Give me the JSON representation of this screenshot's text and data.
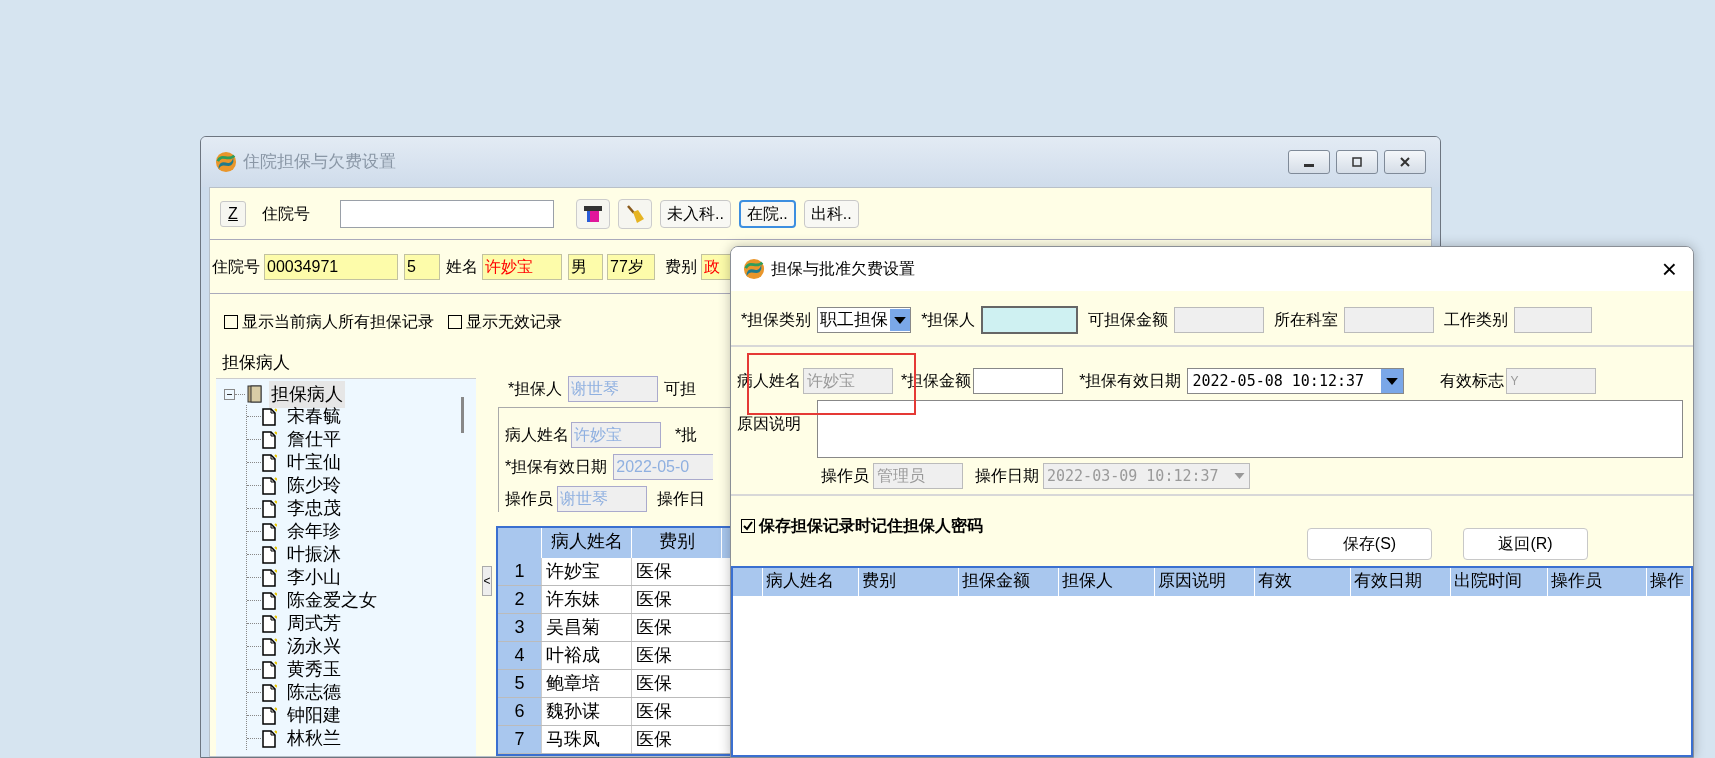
{
  "main_window": {
    "title": "住院担保与欠费设置",
    "toolbar": {
      "z_button": "Z",
      "inpatient_label": "住院号",
      "buttons": [
        {
          "label": "未入科..",
          "selected": false
        },
        {
          "label": "在院..",
          "selected": true
        },
        {
          "label": "出科..",
          "selected": false
        }
      ]
    },
    "patient_info": {
      "id_label": "住院号",
      "id": "00034971",
      "bed": "5",
      "name_label": "姓名",
      "name": "许妙宝",
      "sex": "男",
      "age": "77岁",
      "fee_label": "费别",
      "fee": "政"
    },
    "filters": [
      {
        "label": "显示当前病人所有担保记录",
        "checked": false
      },
      {
        "label": "显示无效记录",
        "checked": false
      }
    ],
    "tree": {
      "title": "担保病人",
      "root": {
        "label": "担保病人",
        "expanded": true,
        "children": [
          {
            "label": "宋春毓"
          },
          {
            "label": "詹仕平"
          },
          {
            "label": "叶宝仙"
          },
          {
            "label": "陈少玲"
          },
          {
            "label": "李忠茂"
          },
          {
            "label": "余年珍"
          },
          {
            "label": "叶振沐"
          },
          {
            "label": "李小山"
          },
          {
            "label": "陈金爱之女"
          },
          {
            "label": "周式芳"
          },
          {
            "label": "汤永兴"
          },
          {
            "label": "黄秀玉"
          },
          {
            "label": "陈志德"
          },
          {
            "label": "钟阳建"
          },
          {
            "label": "林秋兰"
          }
        ]
      }
    },
    "detail": {
      "guarantor_label": "*担保人",
      "guarantor": "谢世琴",
      "amount_label": "可担",
      "patient_label": "病人姓名",
      "patient": "许妙宝",
      "approve_label": "*批",
      "date_label": "*担保有效日期",
      "date": "2022-05-0",
      "operator_label": "操作员",
      "operator": "谢世琴",
      "op_date_label": "操作日"
    },
    "grid": {
      "columns": [
        "",
        "病人姓名",
        "费别"
      ],
      "rows": [
        [
          "1",
          "许妙宝",
          "医保"
        ],
        [
          "2",
          "许东妹",
          "医保"
        ],
        [
          "3",
          "吴昌菊",
          "医保"
        ],
        [
          "4",
          "叶裕成",
          "医保"
        ],
        [
          "5",
          "鲍章培",
          "医保"
        ],
        [
          "6",
          "魏孙谋",
          "医保"
        ],
        [
          "7",
          "马珠凤",
          "医保"
        ]
      ]
    },
    "collapse_button": "<"
  },
  "dialog": {
    "title": "担保与批准欠费设置",
    "close": "×",
    "type_label": "*担保类别",
    "type_value": "职工担保",
    "guarantor_label": "*担保人",
    "amount_label": "可担保金额",
    "dept_label": "所在科室",
    "job_label": "工作类别",
    "patient_label": "病人姓名",
    "patient": "许妙宝",
    "guarantee_amount_label": "*担保金额",
    "valid_date_label": "*担保有效日期",
    "valid_date": "2022-05-08 10:12:37",
    "valid_flag_label": "有效标志",
    "valid_flag": "Y",
    "reason_label": "原因说明",
    "operator_label": "操作员",
    "operator": "管理员",
    "op_date_label": "操作日期",
    "op_date": "2022-03-09 10:12:37",
    "remember": {
      "label": "保存担保记录时记住担保人密码",
      "checked": true
    },
    "buttons": [
      "保存(S)",
      "返回(R)"
    ],
    "grid_columns": [
      "病人姓名",
      "费别",
      "担保金额",
      "担保人",
      "原因说明",
      "有效",
      "有效日期",
      "出院时间",
      "操作员",
      "操作"
    ]
  }
}
